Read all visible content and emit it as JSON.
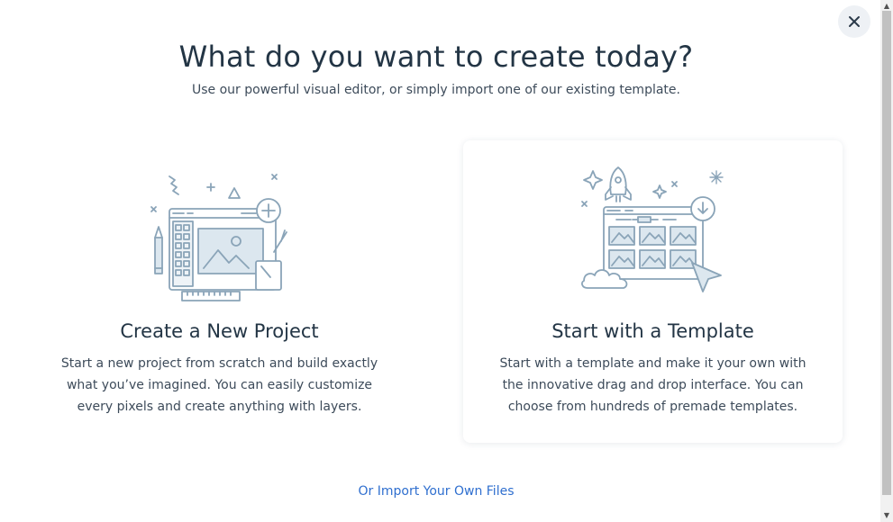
{
  "modal": {
    "title": "What do you want to create today?",
    "subtitle": "Use our powerful visual editor, or simply import one of our existing template.",
    "close_icon": "close-icon"
  },
  "cards": [
    {
      "title": "Create a New Project",
      "description": "Start a new project from scratch and build exactly what you’ve imagined. You can easily customize every pixels and create anything with layers.",
      "icon": "editor-canvas-illustration"
    },
    {
      "title": "Start with a Template",
      "description": "Start with a template and make it your own with the innovative drag and drop interface. You can choose from hundreds of premade templates.",
      "icon": "template-gallery-illustration"
    }
  ],
  "footer": {
    "import_link": "Or Import Your Own Files"
  },
  "colors": {
    "accent": "#2f6fcf",
    "illustration_stroke": "#8aa4b8",
    "illustration_fill": "#dce7ef",
    "heading": "#233545"
  }
}
